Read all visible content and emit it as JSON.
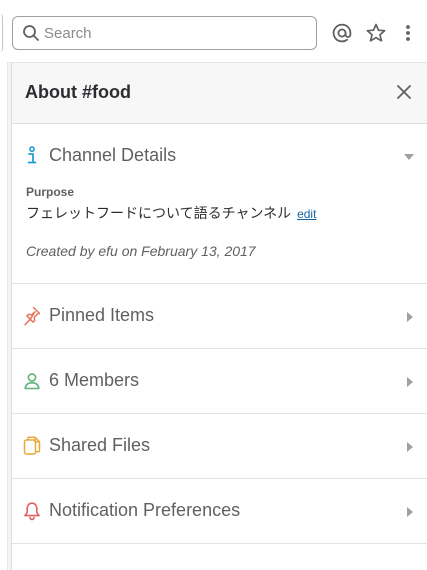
{
  "search": {
    "placeholder": "Search",
    "value": ""
  },
  "topbar_icons": [
    "at-sign-icon",
    "star-icon",
    "more-vertical-icon"
  ],
  "panel": {
    "title": "About #food",
    "close_icon": "close-icon",
    "channel_details": {
      "label": "Channel Details",
      "icon": "info-icon",
      "expanded": true,
      "purpose_label": "Purpose",
      "purpose_text": "フェレットフードについて語るチャンネル",
      "edit_label": "edit",
      "created_by": "Created by efu on February 13, 2017"
    },
    "sections": [
      {
        "label": "Pinned Items",
        "icon": "pin-icon",
        "color": "#e8735a"
      },
      {
        "label": "6 Members",
        "icon": "person-icon",
        "color": "#5fb47a"
      },
      {
        "label": "Shared Files",
        "icon": "files-icon",
        "color": "#e8a93a"
      },
      {
        "label": "Notification Preferences",
        "icon": "bell-icon",
        "color": "#e06060"
      }
    ]
  },
  "colors": {
    "info_icon": "#1d9bd1",
    "link": "#1264a3",
    "header_bg": "#f7f7f7"
  }
}
